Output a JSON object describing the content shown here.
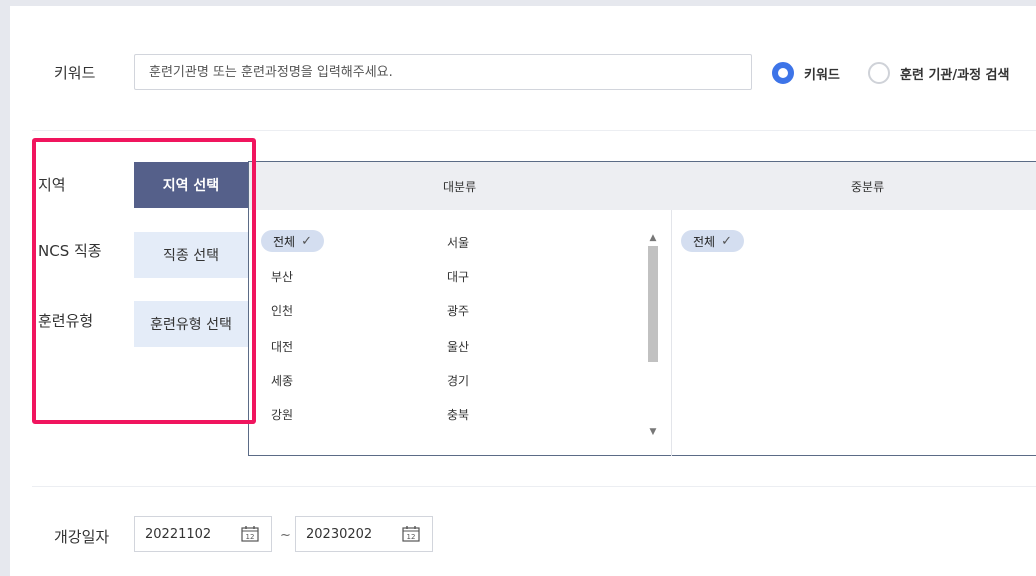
{
  "keyword": {
    "label": "키워드",
    "placeholder": "훈련기관명 또는 훈련과정명을 입력해주세요.",
    "radios": [
      {
        "label": "키워드",
        "selected": true
      },
      {
        "label": "훈련 기관/과정 검색",
        "selected": false
      }
    ]
  },
  "filters": [
    {
      "label": "지역",
      "button": "지역 선택",
      "active": true
    },
    {
      "label": "NCS 직종",
      "button": "직종 선택",
      "active": false
    },
    {
      "label": "훈련유형",
      "button": "훈련유형 선택",
      "active": false
    }
  ],
  "region_panel": {
    "col_major": "대분류",
    "col_middle": "중분류",
    "major_items": [
      "전체",
      "서울",
      "부산",
      "대구",
      "인천",
      "광주",
      "대전",
      "울산",
      "세종",
      "경기",
      "강원",
      "충북"
    ],
    "middle_items": [
      "전체"
    ],
    "selected_major": "전체",
    "check_glyph": "✓"
  },
  "date": {
    "label": "개강일자",
    "start": "20221102",
    "separator": "~",
    "end": "20230202",
    "icon_day": "12"
  },
  "colors": {
    "accent": "#3d74e8",
    "active_button": "#55608a",
    "inactive_button": "#e4ecf8",
    "highlight": "#f0155e",
    "chip": "#d4def0"
  }
}
